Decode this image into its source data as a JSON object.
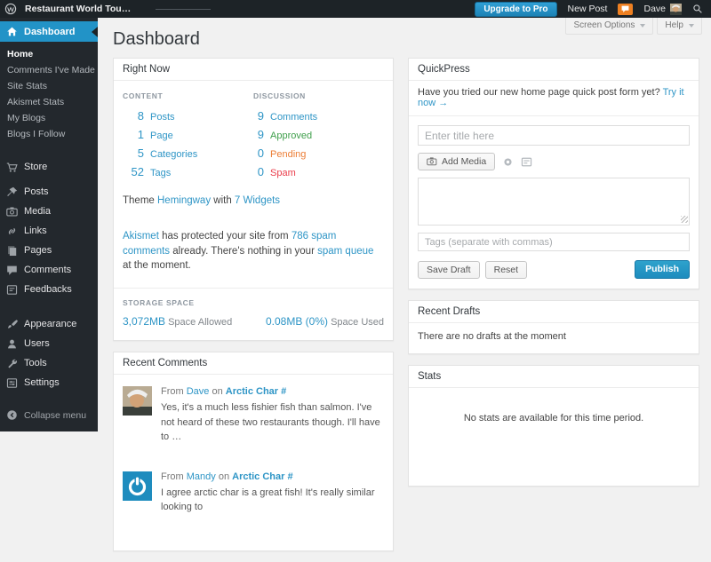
{
  "colors": {
    "admin_bar_bg": "#1d2327",
    "sidebar_bg": "#23282d",
    "active_menu_blue": "#2293c7",
    "link_blue": "#2e95c6",
    "approved_green": "#3f9f4b",
    "pending_orange": "#ec7c33",
    "spam_red": "#ea3d4b",
    "publish_button_blue": "#2ea2cc",
    "notification_orange": "#ee8022",
    "page_bg": "#f1f1f1"
  },
  "topbar": {
    "site_name": "Restaurant World Tou…",
    "upgrade_label": "Upgrade to Pro",
    "new_post_label": "New Post",
    "user_name": "Dave"
  },
  "page": {
    "title": "Dashboard",
    "screen_options_label": "Screen Options",
    "help_label": "Help"
  },
  "sidebar": {
    "dashboard_label": "Dashboard",
    "submenu": [
      {
        "label": "Home"
      },
      {
        "label": "Comments I've Made"
      },
      {
        "label": "Site Stats"
      },
      {
        "label": "Akismet Stats"
      },
      {
        "label": "My Blogs"
      },
      {
        "label": "Blogs I Follow"
      }
    ],
    "menu": [
      {
        "label": "Store",
        "icon": "cart-icon"
      },
      {
        "label": "Posts",
        "icon": "pushpin-icon"
      },
      {
        "label": "Media",
        "icon": "camera-icon"
      },
      {
        "label": "Links",
        "icon": "chain-icon"
      },
      {
        "label": "Pages",
        "icon": "pages-icon"
      },
      {
        "label": "Comments",
        "icon": "comment-bubble-icon"
      },
      {
        "label": "Feedbacks",
        "icon": "feedback-form-icon"
      },
      {
        "label": "Appearance",
        "icon": "brush-icon"
      },
      {
        "label": "Users",
        "icon": "user-icon"
      },
      {
        "label": "Tools",
        "icon": "wrench-icon"
      },
      {
        "label": "Settings",
        "icon": "settings-sliders-icon"
      }
    ],
    "collapse_label": "Collapse menu"
  },
  "right_now": {
    "title": "Right Now",
    "content_header": "CONTENT",
    "discussion_header": "DISCUSSION",
    "content_rows": [
      {
        "num": "8",
        "label": "Posts"
      },
      {
        "num": "1",
        "label": "Page"
      },
      {
        "num": "5",
        "label": "Categories"
      },
      {
        "num": "52",
        "label": "Tags"
      }
    ],
    "discussion_rows": [
      {
        "num": "9",
        "label": "Comments",
        "status": "comments"
      },
      {
        "num": "9",
        "label": "Approved",
        "status": "approved"
      },
      {
        "num": "0",
        "label": "Pending",
        "status": "pending"
      },
      {
        "num": "0",
        "label": "Spam",
        "status": "spam"
      }
    ],
    "theme": {
      "prefix": "Theme ",
      "theme_link": "Hemingway",
      "middle": " with ",
      "widgets_link": "7 Widgets"
    },
    "akismet": {
      "link1": "Akismet",
      "text1": " has protected your site from ",
      "link2": "786 spam comments",
      "text2": " already. There's nothing in your ",
      "link3": "spam queue",
      "text3": " at the moment."
    },
    "storage": {
      "header": "STORAGE SPACE",
      "allowed_value": "3,072MB",
      "allowed_label": " Space Allowed",
      "used_value": "0.08MB (0%)",
      "used_label": " Space Used"
    }
  },
  "recent_comments": {
    "title": "Recent Comments",
    "items": [
      {
        "from": "From ",
        "author": "Dave",
        "on": " on ",
        "post": "Arctic Char #",
        "text": "Yes, it's a much less fishier fish than salmon. I've not heard of these two restaurants though. I'll have to …"
      },
      {
        "from": "From ",
        "author": "Mandy",
        "on": " on ",
        "post": "Arctic Char #",
        "text": "I agree arctic char is a great fish! It's really similar looking to"
      }
    ]
  },
  "quickpress": {
    "title": "QuickPress",
    "notice_text": "Have you tried our new home page quick post form yet? ",
    "notice_link": "Try it now →",
    "title_placeholder": "Enter title here",
    "add_media_label": "Add Media",
    "tags_placeholder": "Tags (separate with commas)",
    "save_draft_label": "Save Draft",
    "reset_label": "Reset",
    "publish_label": "Publish"
  },
  "recent_drafts": {
    "title": "Recent Drafts",
    "empty_text": "There are no drafts at the moment"
  },
  "stats": {
    "title": "Stats",
    "empty_text": "No stats are available for this time period."
  }
}
